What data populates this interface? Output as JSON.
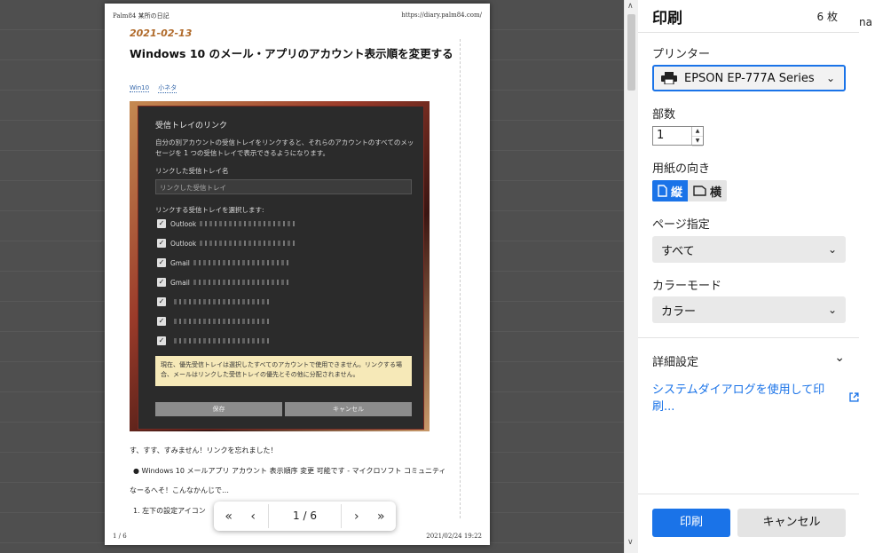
{
  "preview": {
    "header_left": "Palm84 某所の日記",
    "header_right": "https://diary.palm84.com/",
    "post_date": "2021-02-13",
    "post_title": "Windows 10 のメール・アプリのアカウント表示順を変更する",
    "tags": [
      "Win10",
      "小ネタ"
    ],
    "dialog": {
      "title": "受信トレイのリンク",
      "description": "自分の別アカウントの受信トレイをリンクすると、それらのアカウントのすべてのメッセージを 1 つの受信トレイで表示できるようになります。",
      "name_label": "リンクした受信トレイ名",
      "name_placeholder": "リンクした受信トレイ",
      "select_label": "リンクする受信トレイを選択します:",
      "accounts": [
        "Outlook",
        "Outlook",
        "Gmail",
        "Gmail",
        "",
        "",
        ""
      ],
      "note": "現在、優先受信トレイは選択したすべてのアカウントで使用できません。リンクする場合、メールはリンクした受信トレイの優先とその他に分配されません。",
      "save": "保存",
      "cancel": "キャンセル"
    },
    "body_line1": "す、すす、すみません！リンクを忘れました！",
    "body_bullet": "● Windows 10 メールアプリ アカウント 表示順序 変更 可能です - マイクロソフト コミュニティ",
    "body_line3": "なーるへそ！こんなかんじで…",
    "body_line4": "1. 左下の設定アイコン",
    "footer_left": "1 / 6",
    "footer_right": "2021/02/24 19:22",
    "page_indicator": "1 / 6"
  },
  "edge_text": "na",
  "panel": {
    "title": "印刷",
    "sheets": "6 枚",
    "printer_label": "プリンター",
    "printer_value": "EPSON EP-777A Series",
    "copies_label": "部数",
    "copies_value": "1",
    "orientation_label": "用紙の向き",
    "portrait": "縦",
    "landscape": "横",
    "pages_label": "ページ指定",
    "pages_value": "すべて",
    "color_label": "カラーモード",
    "color_value": "カラー",
    "advanced_label": "詳細設定",
    "system_dialog_link": "システムダイアログを使用して印刷...",
    "print_button": "印刷",
    "cancel_button": "キャンセル",
    "accent": "#1a73e8"
  }
}
